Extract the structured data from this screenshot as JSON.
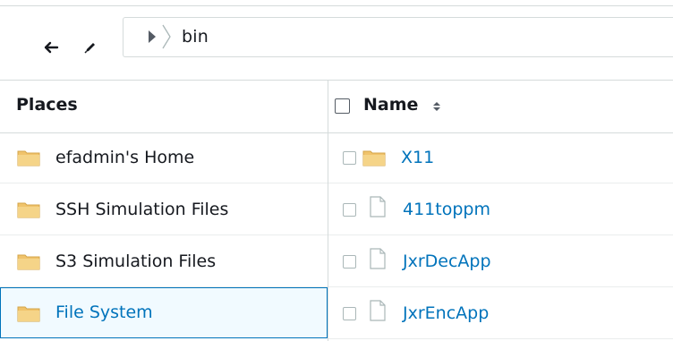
{
  "toolbar": {
    "back_icon": "arrow-left-icon",
    "edit_icon": "pencil-icon"
  },
  "path": {
    "current": "bin",
    "icon": "chevron-right-icon"
  },
  "places": {
    "header": "Places",
    "items": [
      {
        "label": "efadmin's Home",
        "icon": "folder-icon",
        "selected": false
      },
      {
        "label": "SSH Simulation Files",
        "icon": "folder-icon",
        "selected": false
      },
      {
        "label": "S3 Simulation Files",
        "icon": "folder-icon",
        "selected": false
      },
      {
        "label": "File System",
        "icon": "folder-icon",
        "selected": true
      }
    ]
  },
  "files": {
    "header": "Name",
    "sort_icon": "sort-updown-icon",
    "items": [
      {
        "name": "X11",
        "type": "folder",
        "icon": "folder-icon"
      },
      {
        "name": "411toppm",
        "type": "file",
        "icon": "document-icon"
      },
      {
        "name": "JxrDecApp",
        "type": "file",
        "icon": "document-icon"
      },
      {
        "name": "JxrEncApp",
        "type": "file",
        "icon": "document-icon"
      }
    ]
  },
  "colors": {
    "link": "#0073bb",
    "folder": "#f0c36b",
    "border": "#d5dbdb",
    "selected_border": "#0073bb"
  }
}
